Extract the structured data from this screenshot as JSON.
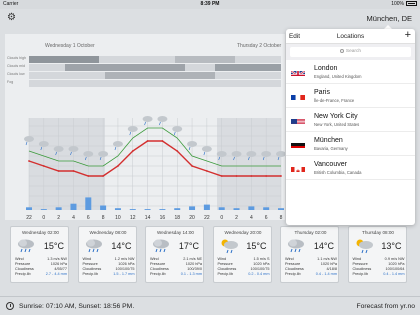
{
  "status_bar": {
    "carrier": "Carrier",
    "time": "8:39 PM",
    "battery": "100%"
  },
  "header": {
    "location_title": "München, DE"
  },
  "chart": {
    "day_labels": [
      "Wednesday 1 October",
      "Thursday 2 October"
    ],
    "side_labels": [
      "Clouds high",
      "Clouds mid",
      "Clouds low",
      "Fog"
    ],
    "hour_labels": [
      "22",
      "0",
      "2",
      "4",
      "6",
      "8",
      "10",
      "12",
      "14",
      "16",
      "18",
      "20",
      "22",
      "0",
      "2",
      "4",
      "6",
      "8"
    ],
    "precip_labels": [
      "0.3",
      "0.1",
      "0.3",
      "0.7",
      "1.4",
      "",
      "",
      "",
      "",
      "",
      "",
      "",
      "",
      "",
      "",
      "",
      "",
      ""
    ]
  },
  "chart_data": {
    "type": "line",
    "x": [
      "22",
      "0",
      "2",
      "4",
      "6",
      "8",
      "10",
      "12",
      "14",
      "16",
      "18",
      "20",
      "22",
      "0",
      "2",
      "4",
      "6",
      "8"
    ],
    "series": [
      {
        "values": [
          15,
          14,
          13,
          13,
          12,
          12,
          14,
          17,
          19,
          19,
          17,
          14,
          13,
          12,
          12,
          12,
          12,
          12
        ]
      }
    ],
    "grid": true,
    "legend": "none"
  },
  "popover": {
    "edit_label": "Edit",
    "title": "Locations",
    "add_label": "+",
    "search_placeholder": "Search",
    "locations": [
      {
        "name": "London",
        "region": "England, United Kingdom",
        "flag": "uk"
      },
      {
        "name": "Paris",
        "region": "Île-de-France, France",
        "flag": "fr"
      },
      {
        "name": "New York City",
        "region": "New York, United States",
        "flag": "us"
      },
      {
        "name": "München",
        "region": "Bavaria, Germany",
        "flag": "de"
      },
      {
        "name": "Vancouver",
        "region": "British Columbia, Canada",
        "flag": "ca"
      }
    ]
  },
  "forecast_cards": [
    {
      "time": "Wednesday 02:00",
      "temp": "15°C",
      "wind": "1.3 m/s NW",
      "pressure": "1026 hPa",
      "cloudiness": "4/55/77",
      "precip": "2.7 - 4.4 mm",
      "icon": "rain-cloud-icon"
    },
    {
      "time": "Wednesday 08:00",
      "temp": "14°C",
      "wind": "1.2 m/s NW",
      "pressure": "1026 hPa",
      "cloudiness": "100/100/75",
      "precip": "1.5 - 1.7 mm",
      "icon": "rain-cloud-icon"
    },
    {
      "time": "Wednesday 14:00",
      "temp": "17°C",
      "wind": "2.1 m/s NE",
      "pressure": "1020 hPa",
      "cloudiness": "100/39/0",
      "precip": "0.1 - 1.3 mm",
      "icon": "rain-cloud-icon"
    },
    {
      "time": "Wednesday 20:00",
      "temp": "15°C",
      "wind": "1.5 m/s S",
      "pressure": "1020 hPa",
      "cloudiness": "100/100/75",
      "precip": "0.2 - 0.4 mm",
      "icon": "sun-rain-icon"
    },
    {
      "time": "Thursday 02:00",
      "temp": "14°C",
      "wind": "1.1 m/s NW",
      "pressure": "1020 hPa",
      "cloudiness": "4/18/8",
      "precip": "0.4 - 1.4 mm",
      "icon": "rain-cloud-icon"
    },
    {
      "time": "Thursday 08:00",
      "temp": "13°C",
      "wind": "0.9 m/s NW",
      "pressure": "1020 hPa",
      "cloudiness": "100/100/64",
      "precip": "0.4 - 1.4 mm",
      "icon": "sun-rain-icon"
    }
  ],
  "card_field_labels": {
    "wind": "Wind",
    "pressure": "Pressure",
    "cloudiness": "Cloudiness",
    "precip": "Precip.lib"
  },
  "footer": {
    "sun_times": "Sunrise: 07:10 AM, Sunset: 18:56 PM.",
    "source": "Forecast from yr.no"
  }
}
